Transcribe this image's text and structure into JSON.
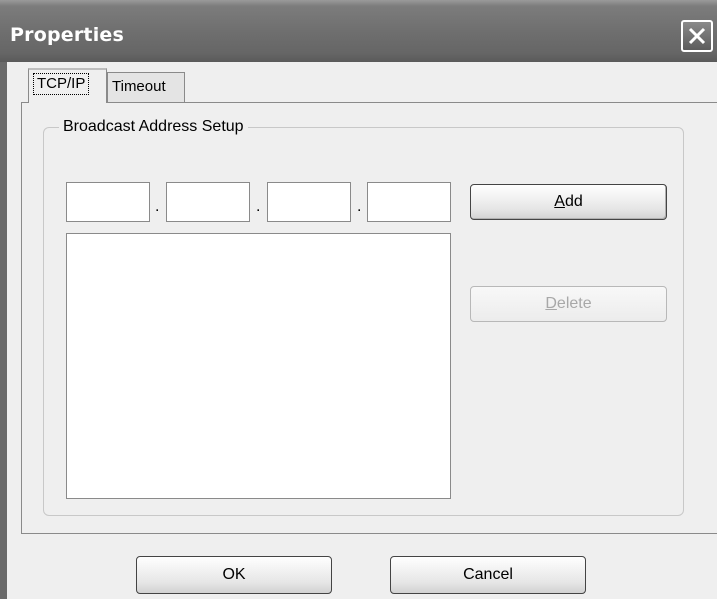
{
  "window": {
    "title": "Properties",
    "close_icon": "close-icon"
  },
  "tabs": [
    {
      "label": "TCP/IP",
      "selected": true
    },
    {
      "label": "Timeout",
      "selected": false
    }
  ],
  "broadcast": {
    "group_label": "Broadcast Address Setup",
    "ip_octets": [
      "",
      "",
      "",
      ""
    ],
    "separators": [
      ".",
      ".",
      "."
    ],
    "address_list": [],
    "add_label": "Add",
    "add_mnemonic": "A",
    "delete_label": "Delete",
    "delete_mnemonic": "D",
    "delete_enabled": false
  },
  "footer": {
    "ok_label": "OK",
    "cancel_label": "Cancel"
  }
}
